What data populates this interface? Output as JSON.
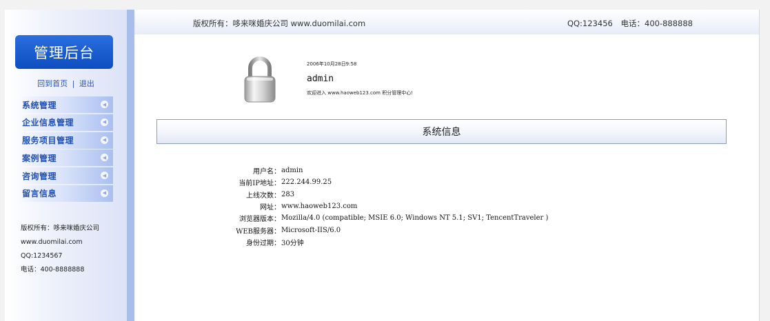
{
  "sidebar": {
    "title": "管理后台",
    "links": {
      "home": "回到首页",
      "separator": "|",
      "logout": "退出"
    },
    "menu": [
      {
        "label": "系统管理"
      },
      {
        "label": "企业信息管理"
      },
      {
        "label": "服务项目管理"
      },
      {
        "label": "案例管理"
      },
      {
        "label": "咨询管理"
      },
      {
        "label": "留言信息"
      }
    ],
    "contact": {
      "copyright": "版权所有：哆来咪婚庆公司",
      "website": "www.duomilai.com",
      "qq": "QQ:1234567",
      "phone": "电话：400-8888888"
    }
  },
  "topbar": {
    "copyright": "版权所有：哆来咪婚庆公司 www.duomilai.com",
    "qq": "QQ:123456",
    "phone": "电话：400-888888"
  },
  "welcome": {
    "datetime": "2006年10月28日9:58",
    "username": "admin",
    "greeting": "欢迎进入 www.haoweb123.com 积分管理中心!"
  },
  "section": {
    "title": "系统信息"
  },
  "system_info": [
    {
      "label": "用户名：",
      "value": "admin"
    },
    {
      "label": "当前IP地址：",
      "value": "222.244.99.25"
    },
    {
      "label": "上线次数：",
      "value": "283"
    },
    {
      "label": "网址：",
      "value": "www.haoweb123.com"
    },
    {
      "label": "浏览器版本：",
      "value": "Mozilla/4.0 (compatible; MSIE 6.0; Windows NT 5.1; SV1; TencentTraveler )"
    },
    {
      "label": "WEB服务器：",
      "value": "Microsoft-IIS/6.0"
    },
    {
      "label": "身份过期：",
      "value": "30分钟"
    }
  ],
  "icons": {
    "lock": "lock-icon",
    "menu_arrow": "chevron-left-icon"
  },
  "colors": {
    "accent": "#0d4dbf",
    "menu_text": "#1f4fb3",
    "sidebar_stripe": "#a8bde9"
  }
}
